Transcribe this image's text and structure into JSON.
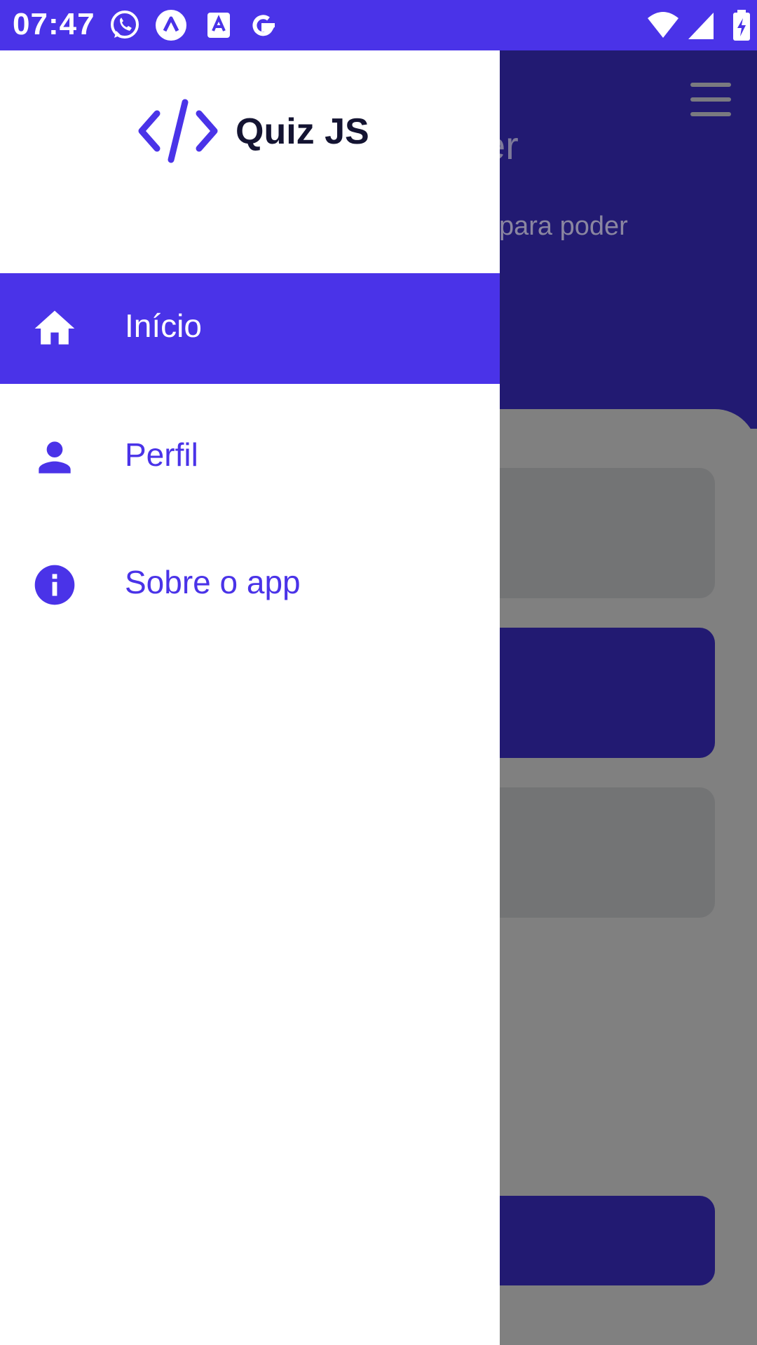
{
  "status_bar": {
    "time": "07:47",
    "notification_icons": [
      "whatsapp-icon",
      "vpn-icon",
      "translate-icon",
      "google-icon"
    ],
    "system_icons": [
      "wifi-icon",
      "signal-icon",
      "battery-charging-icon"
    ]
  },
  "drawer": {
    "title": "Quiz JS",
    "logo_icon": "code-icon",
    "items": [
      {
        "label": "Início",
        "icon": "home-icon",
        "active": true
      },
      {
        "label": "Perfil",
        "icon": "person-icon",
        "active": false
      },
      {
        "label": "Sobre o app",
        "icon": "info-icon",
        "active": false
      }
    ]
  },
  "background": {
    "header_title_fragment": "er",
    "header_subtitle_fragment": "para poder",
    "menu_icon": "hamburger-icon"
  },
  "colors": {
    "primary": "#4A33E8",
    "dimmed_primary": "#221A72",
    "scrim": "#808080",
    "drawer_bg": "#FFFFFF"
  }
}
